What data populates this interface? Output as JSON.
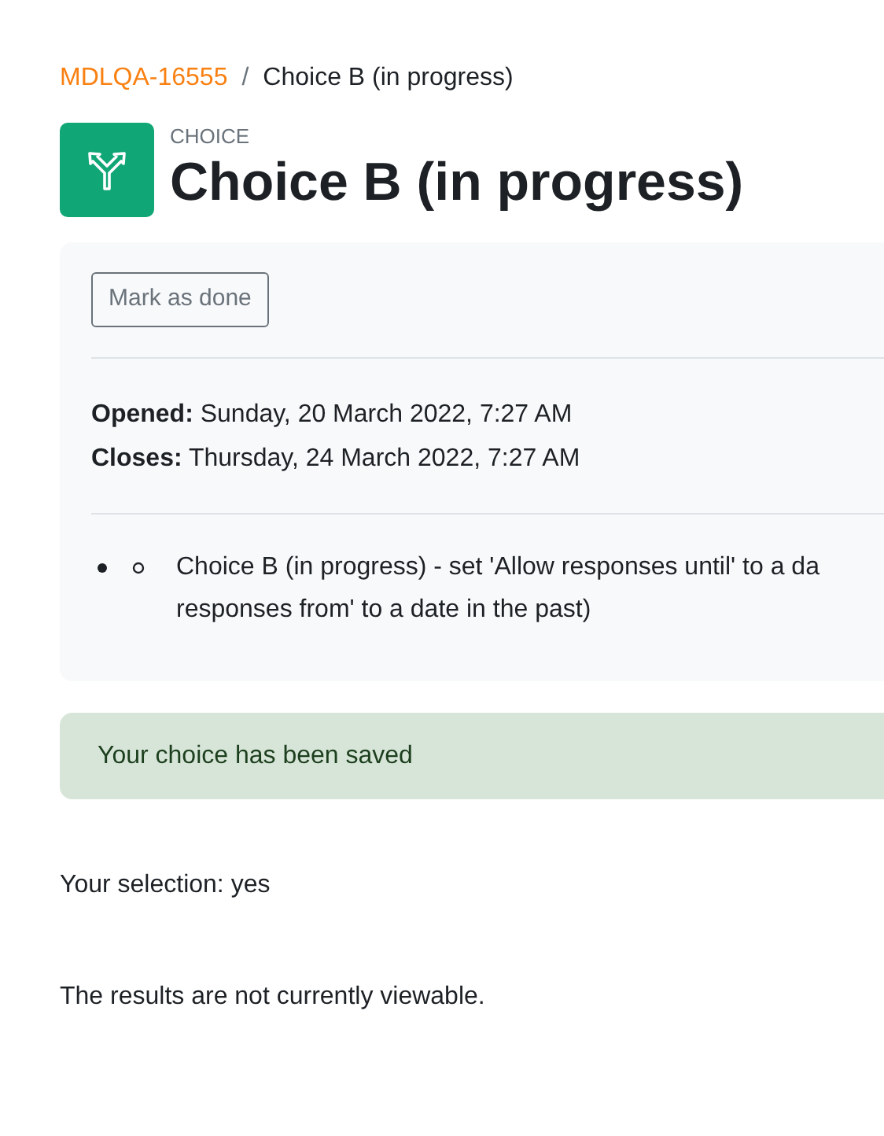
{
  "breadcrumb": [
    {
      "label": "MDLQA-16555",
      "kind": "link"
    },
    {
      "label": "/",
      "kind": "separator"
    },
    {
      "label": "Choice B (in progress)",
      "kind": "current"
    }
  ],
  "header": {
    "module_type": "CHOICE",
    "title": "Choice B (in progress)"
  },
  "completion_button": "Mark as done",
  "dates": [
    {
      "label": "Opened:",
      "value": "Sunday, 20 March 2022, 7:27 AM"
    },
    {
      "label": "Closes:",
      "value": "Thursday, 24 March 2022, 7:27 AM"
    }
  ],
  "description_lines": [
    "Choice B (in progress) - set 'Allow responses until' to a da",
    "responses from' to a date in the past)"
  ],
  "alert": "Your choice has been saved",
  "selection": "Your selection: yes",
  "results_note": "The results are not currently viewable."
}
